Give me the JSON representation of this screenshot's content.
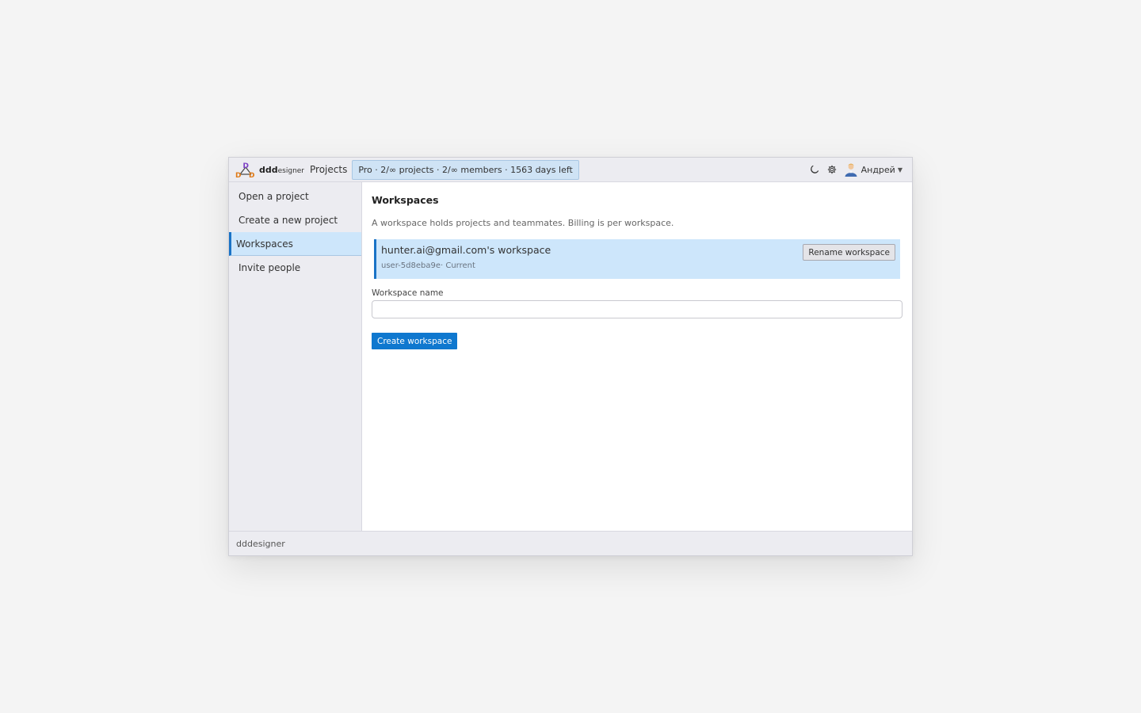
{
  "brand": {
    "logo_letters": "DDD",
    "name_bold": "ddd",
    "name_rest": "esigner"
  },
  "header": {
    "projects_label": "Projects",
    "plan_badge": "Pro · 2/∞ projects · 2/∞ members · 1563 days left",
    "user_name": "Андрей",
    "icons": [
      "moon-icon",
      "gear-icon",
      "user-avatar-icon",
      "caret-down-icon"
    ]
  },
  "sidebar": {
    "items": [
      {
        "label": "Open a project",
        "active": false
      },
      {
        "label": "Create a new project",
        "active": false
      },
      {
        "label": "Workspaces",
        "active": true
      },
      {
        "label": "Invite people",
        "active": false
      }
    ]
  },
  "main": {
    "title": "Workspaces",
    "description": "A workspace holds projects and teammates. Billing is per workspace.",
    "workspace": {
      "name": "hunter.ai@gmail.com's workspace",
      "meta": "user-5d8eba9e· Current",
      "rename_label": "Rename workspace"
    },
    "form": {
      "field_label": "Workspace name",
      "field_value": "",
      "create_label": "Create workspace"
    }
  },
  "footer": {
    "text": "dddesigner"
  },
  "colors": {
    "accent": "#0f78cf",
    "active_bg": "#cde6fb",
    "chrome_bg": "#ececf1"
  }
}
